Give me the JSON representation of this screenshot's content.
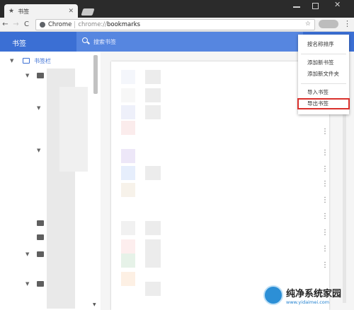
{
  "browser": {
    "tab_title": "书签",
    "tab_close": "✕",
    "url_scheme": "Chrome",
    "url_prefix": "chrome://",
    "url_path": "bookmarks",
    "nav_back": "←",
    "nav_forward": "→",
    "nav_reload": "C",
    "star": "☆",
    "menu": "⋮"
  },
  "header": {
    "title": "书签",
    "search_placeholder": "搜索书签"
  },
  "sidebar": {
    "root_label": "书签栏"
  },
  "list": {
    "row_menu_glyph": "⋮"
  },
  "context_menu": {
    "items": [
      "按名称排序",
      "添加新书签",
      "添加新文件夹",
      "导入书签",
      "导出书签"
    ],
    "highlighted": "导出书签",
    "highlight_color": "#d9302c"
  },
  "watermark": {
    "title": "纯净系统家园",
    "url": "www.yidaimei.com"
  },
  "colors": {
    "accent": "#3b6fd4",
    "search_bg": "#5686e0"
  }
}
